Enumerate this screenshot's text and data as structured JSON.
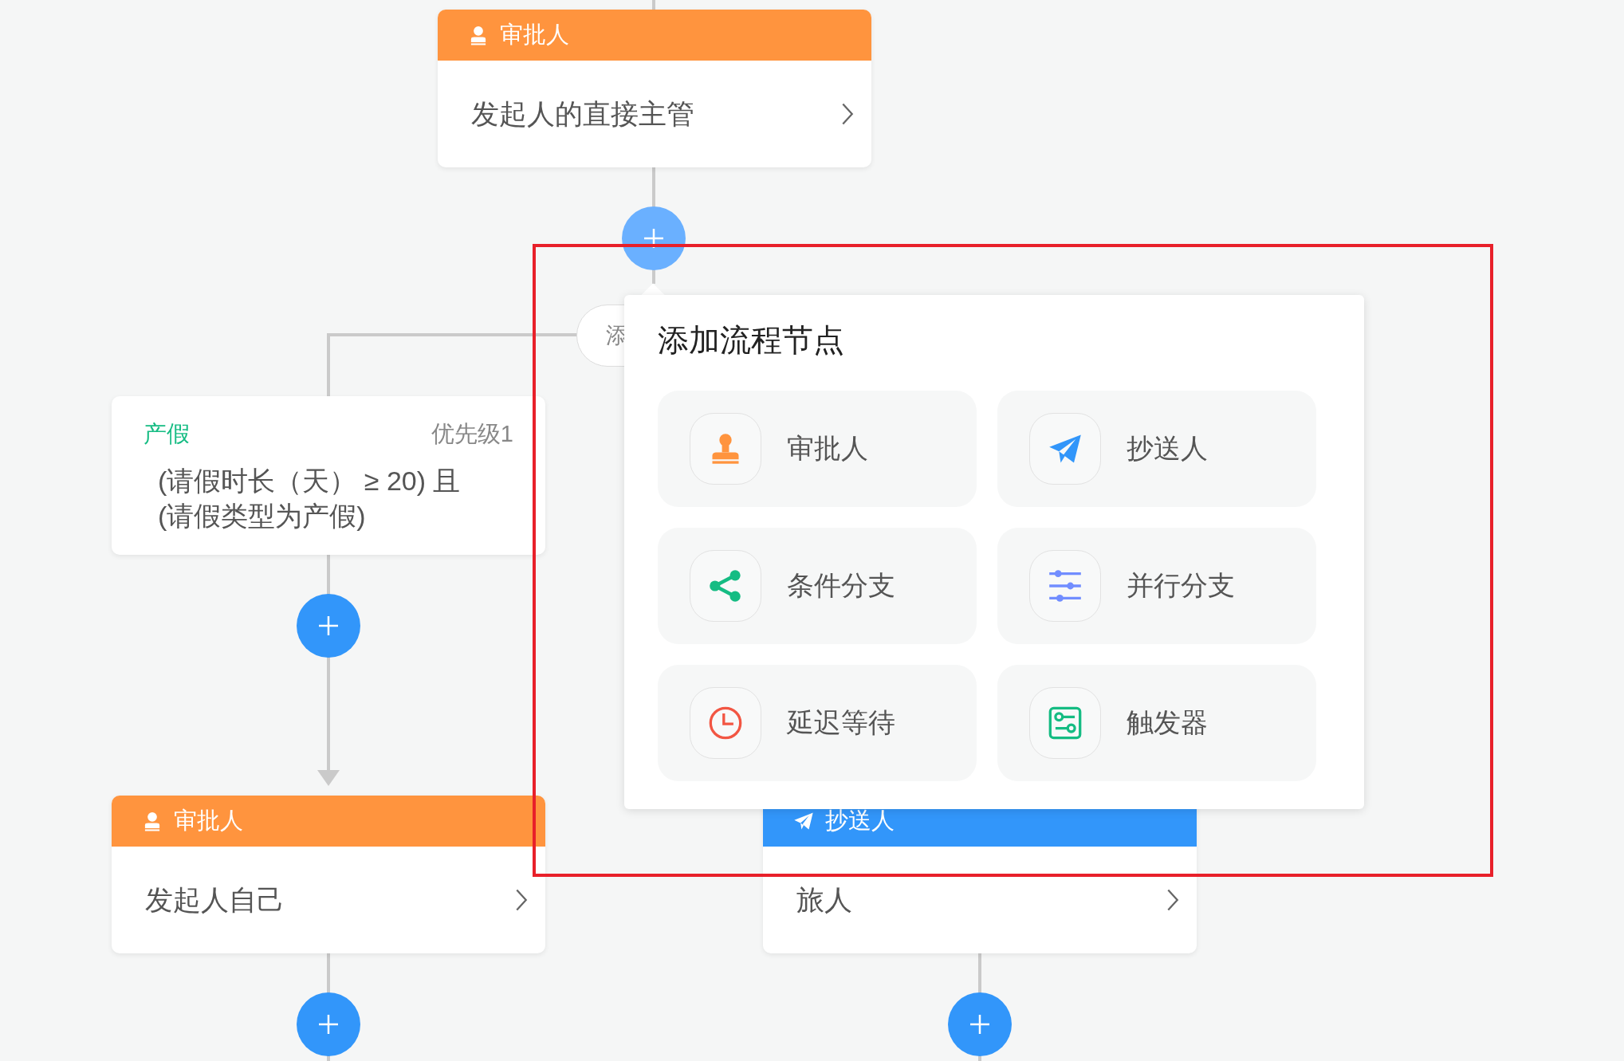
{
  "top_node": {
    "kind": "approver",
    "title": "审批人",
    "content": "发起人的直接主管"
  },
  "add_branch_button": {
    "label": "添"
  },
  "condition_node": {
    "name": "产假",
    "priority": "优先级1",
    "lines": [
      "(请假时长（天） ≥ 20) 且",
      "(请假类型为产假)"
    ]
  },
  "bottom_nodes": [
    {
      "kind": "approver",
      "title": "审批人",
      "content": "发起人自己"
    },
    {
      "kind": "cc",
      "title": "抄送人",
      "content": "旅人"
    }
  ],
  "add_buttons": [
    {
      "active": true
    },
    {
      "active": false
    },
    {
      "active": false
    },
    {
      "active": false
    }
  ],
  "popover": {
    "title": "添加流程节点",
    "items": [
      {
        "kind": "approver",
        "label": "审批人"
      },
      {
        "kind": "cc",
        "label": "抄送人"
      },
      {
        "kind": "condition",
        "label": "条件分支"
      },
      {
        "kind": "parallel",
        "label": "并行分支"
      },
      {
        "kind": "delay",
        "label": "延迟等待"
      },
      {
        "kind": "trigger",
        "label": "触发器"
      }
    ]
  }
}
